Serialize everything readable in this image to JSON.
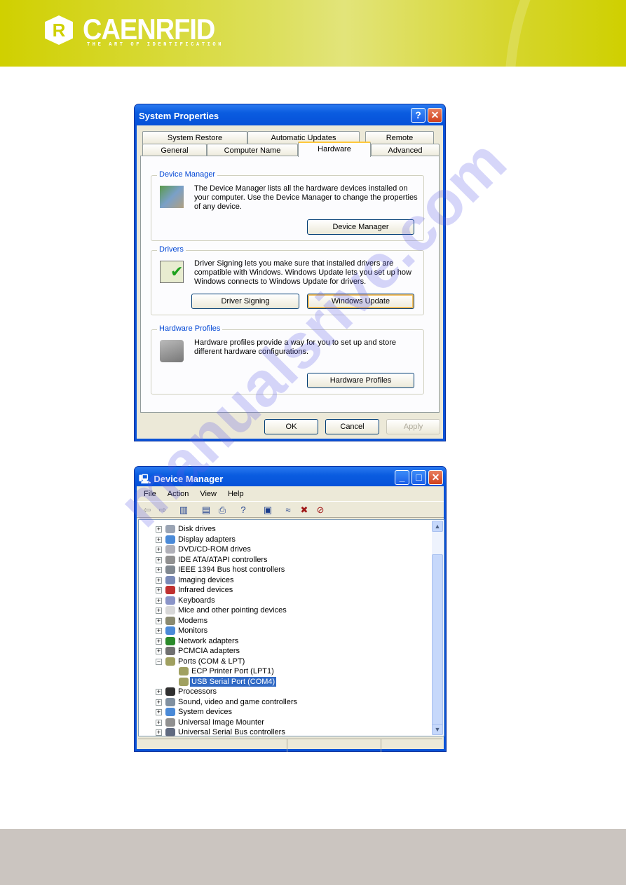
{
  "header": {
    "logo": "CAENRFID",
    "tagline": "THE ART OF IDENTIFICATION",
    "logo_mark": "R"
  },
  "system_properties": {
    "title": "System Properties",
    "help_button": "?",
    "close_button": "✕",
    "tabs_row1": [
      "System Restore",
      "Automatic Updates",
      "Remote"
    ],
    "tabs_row2": [
      "General",
      "Computer Name",
      "Hardware",
      "Advanced"
    ],
    "selected_tab": "Hardware",
    "groups": [
      {
        "label": "Device Manager",
        "icon": "device-manager-icon",
        "text": "The Device Manager lists all the hardware devices installed on your computer. Use the Device Manager to change the properties of any device.",
        "buttons": [
          "Device Manager"
        ]
      },
      {
        "label": "Drivers",
        "icon": "driver-signing-icon",
        "text": "Driver Signing lets you make sure that installed drivers are compatible with Windows. Windows Update lets you set up how Windows connects to Windows Update for drivers.",
        "buttons": [
          "Driver Signing",
          "Windows Update"
        ]
      },
      {
        "label": "Hardware Profiles",
        "icon": "hardware-profiles-icon",
        "text": "Hardware profiles provide a way for you to set up and store different hardware configurations.",
        "buttons": [
          "Hardware Profiles"
        ]
      }
    ],
    "ok": "OK",
    "cancel": "Cancel",
    "apply": "Apply"
  },
  "device_manager": {
    "title": "Device Manager",
    "menu": [
      "File",
      "Action",
      "View",
      "Help"
    ],
    "toolbar": [
      "back-icon",
      "forward-icon",
      "show-hide-tree-icon",
      "properties-icon",
      "print-icon",
      "help-icon",
      "scan-hardware-icon",
      "update-driver-icon",
      "uninstall-icon",
      "disable-icon"
    ],
    "tree": [
      {
        "label": "Disk drives",
        "level": 1,
        "state": "collapsed"
      },
      {
        "label": "Display adapters",
        "level": 1,
        "state": "collapsed"
      },
      {
        "label": "DVD/CD-ROM drives",
        "level": 1,
        "state": "collapsed"
      },
      {
        "label": "IDE ATA/ATAPI controllers",
        "level": 1,
        "state": "collapsed"
      },
      {
        "label": "IEEE 1394 Bus host controllers",
        "level": 1,
        "state": "collapsed"
      },
      {
        "label": "Imaging devices",
        "level": 1,
        "state": "collapsed"
      },
      {
        "label": "Infrared devices",
        "level": 1,
        "state": "collapsed"
      },
      {
        "label": "Keyboards",
        "level": 1,
        "state": "collapsed"
      },
      {
        "label": "Mice and other pointing devices",
        "level": 1,
        "state": "collapsed"
      },
      {
        "label": "Modems",
        "level": 1,
        "state": "collapsed"
      },
      {
        "label": "Monitors",
        "level": 1,
        "state": "collapsed"
      },
      {
        "label": "Network adapters",
        "level": 1,
        "state": "collapsed"
      },
      {
        "label": "PCMCIA adapters",
        "level": 1,
        "state": "collapsed"
      },
      {
        "label": "Ports (COM & LPT)",
        "level": 1,
        "state": "expanded"
      },
      {
        "label": "ECP Printer Port (LPT1)",
        "level": 2,
        "state": "leaf"
      },
      {
        "label": "USB Serial Port (COM4)",
        "level": 2,
        "state": "leaf",
        "selected": true
      },
      {
        "label": "Processors",
        "level": 1,
        "state": "collapsed"
      },
      {
        "label": "Sound, video and game controllers",
        "level": 1,
        "state": "collapsed"
      },
      {
        "label": "System devices",
        "level": 1,
        "state": "collapsed"
      },
      {
        "label": "Universal Image Mounter",
        "level": 1,
        "state": "collapsed"
      },
      {
        "label": "Universal Serial Bus controllers",
        "level": 1,
        "state": "collapsed"
      }
    ]
  },
  "colors": {
    "header": "#cfd000",
    "xp_title": "#0a5ce0",
    "selection": "#316ac5",
    "footer": "#cbc5c0"
  },
  "watermark": "manualsrive.com"
}
